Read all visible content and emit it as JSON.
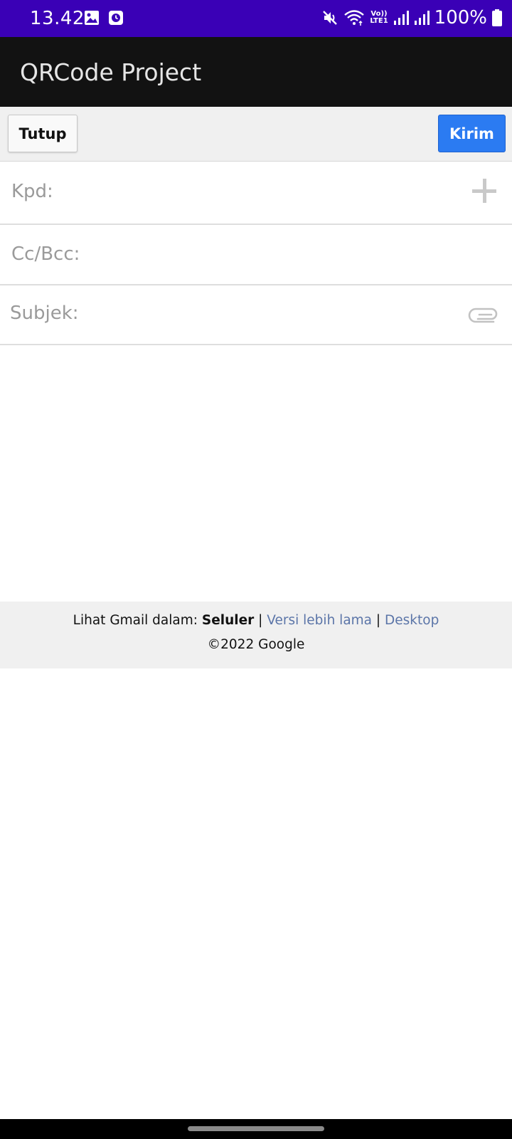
{
  "status_bar": {
    "time": "13.42",
    "left_icons": [
      "image-icon",
      "clock-app-icon"
    ],
    "right_icons": [
      "mute-icon",
      "wifi-icon",
      "volte-icon",
      "signal-icon",
      "signal-icon"
    ],
    "volte_label": "Vo))",
    "lte_label": "LTE1",
    "battery_percent": "100%",
    "background_color": "#3a00b6"
  },
  "app_bar": {
    "title": "QRCode Project",
    "background_color": "#121212"
  },
  "toolbar": {
    "close_label": "Tutup",
    "send_label": "Kirim",
    "send_color": "#2b7bf2"
  },
  "compose": {
    "to_label": "Kpd:",
    "cc_bcc_label": "Cc/Bcc:",
    "subject_label": "Subjek:",
    "to_icon": "plus-icon",
    "subject_icon": "paperclip-icon"
  },
  "footer": {
    "view_prefix": "Lihat Gmail dalam:",
    "view_mobile": "Seluler",
    "separator": "|",
    "view_older": "Versi lebih lama",
    "view_desktop": "Desktop",
    "copyright": "©2022 Google",
    "link_color": "#5b75a8"
  }
}
